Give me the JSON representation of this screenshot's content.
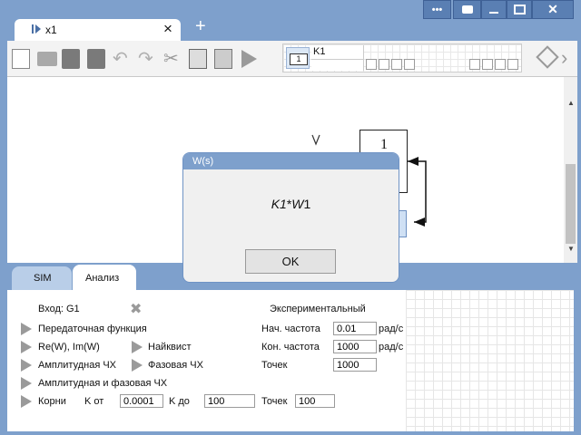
{
  "tab": {
    "title": "x1",
    "close": "×",
    "new": "+"
  },
  "toolbar": {
    "block_label": "K1",
    "block_number": "1"
  },
  "canvas": {
    "block_value": "1"
  },
  "dialog": {
    "title": "W(s)",
    "formula_k": "K1",
    "formula_star": "*",
    "formula_w": "W",
    "formula_sub": "1",
    "ok_label": "OK"
  },
  "bottom_tabs": {
    "sim": "SIM",
    "analysis": "Анализ"
  },
  "analysis": {
    "input_label": "Вход: G1",
    "experimental": "Экспериментальный",
    "transfer_function": "Передаточная функция",
    "re_im": "Re(W), Im(W)",
    "nyquist": "Найквист",
    "amplitude": "Амплитудная ЧХ",
    "phase": "Фазовая ЧХ",
    "amp_phase": "Амплитудная и фазовая ЧХ",
    "roots": "Корни",
    "k_from_label": "K от",
    "k_from": "0.0001",
    "k_to_label": "K до",
    "k_to": "100",
    "points_label": "Точек",
    "roots_points": "100",
    "start_freq_label": "Нач. частота",
    "start_freq": "0.01",
    "end_freq_label": "Кон. частота",
    "end_freq": "1000",
    "unit": "рад/с",
    "exp_points_label": "Точек",
    "exp_points": "1000"
  }
}
